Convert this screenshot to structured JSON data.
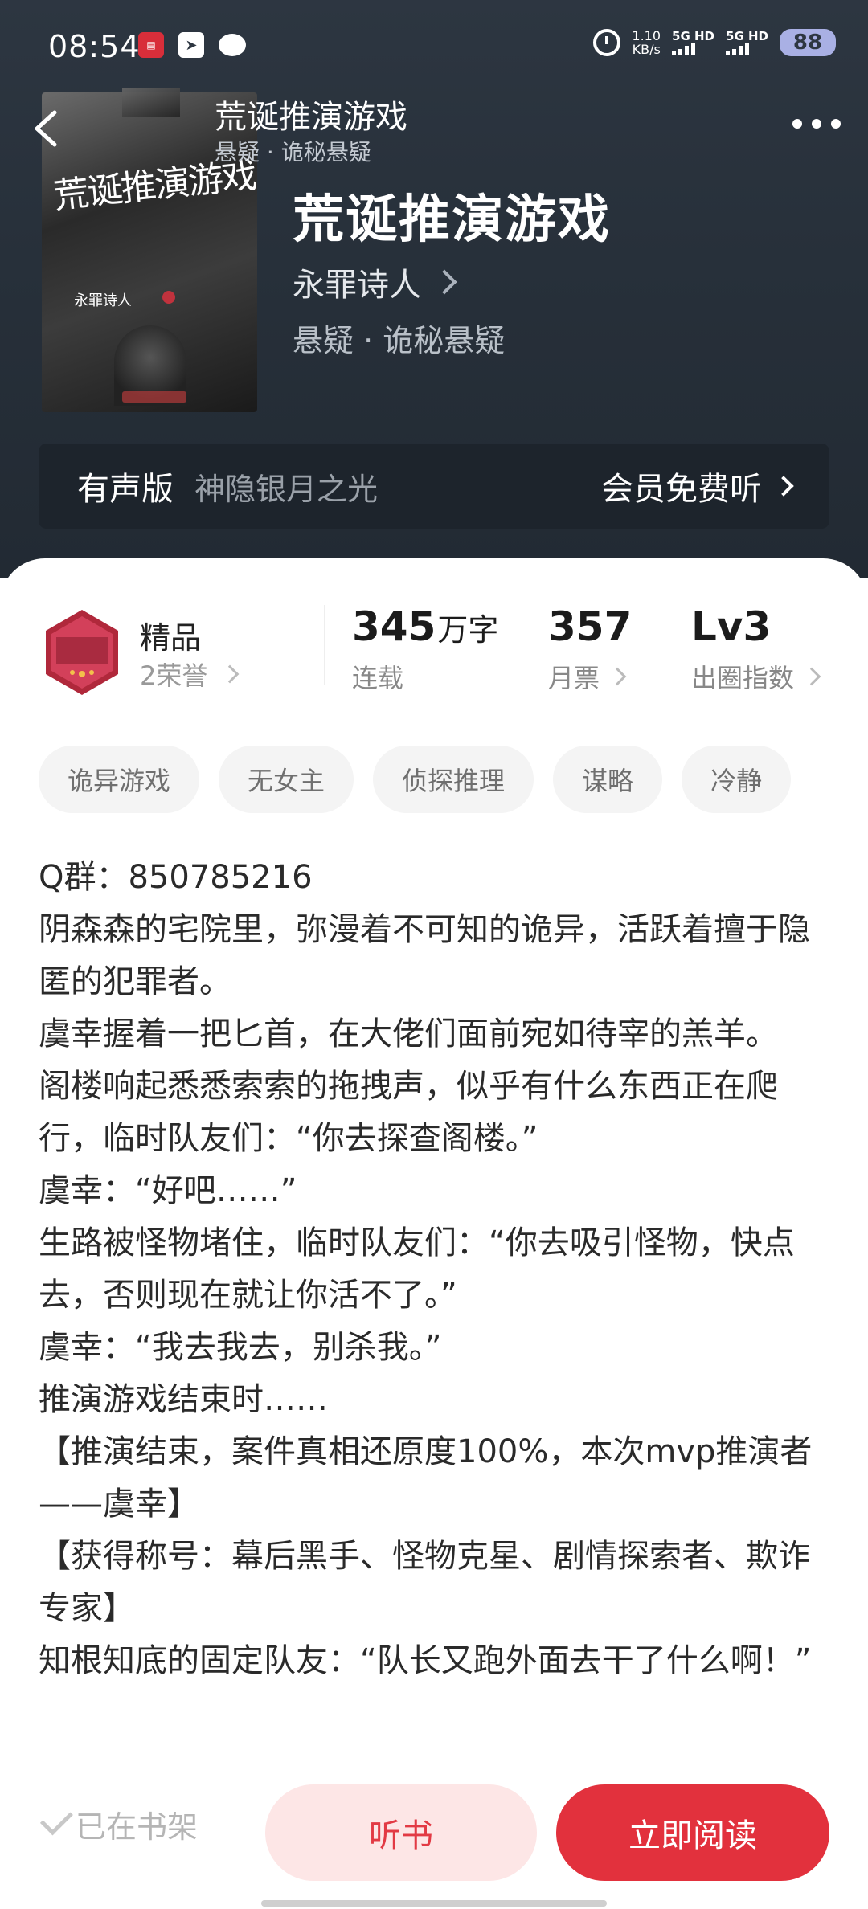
{
  "status_bar": {
    "time": "08:54",
    "net_speed_value": "1.10",
    "net_speed_unit": "KB/s",
    "sim1": "5G HD",
    "sim2": "5G HD",
    "battery": "88"
  },
  "header": {
    "title": "荒诞推演游戏",
    "subtitle": "悬疑 · 诡秘悬疑"
  },
  "book": {
    "title": "荒诞推演游戏",
    "author": "永罪诗人",
    "genre": "悬疑 · 诡秘悬疑",
    "cover_title": "荒诞推演游戏",
    "cover_author": "永罪诗人"
  },
  "audio": {
    "label": "有声版",
    "narrator": "神隐银月之光",
    "cta": "会员免费听"
  },
  "stats": {
    "honor_title": "精品",
    "honor_sub": "2荣誉",
    "words_value": "345",
    "words_unit": "万字",
    "words_label": "连载",
    "monthly_value": "357",
    "monthly_label": "月票",
    "level_value": "Lv3",
    "level_label": "出圈指数"
  },
  "tags": [
    "诡异游戏",
    "无女主",
    "侦探推理",
    "谋略",
    "冷静"
  ],
  "description": [
    "Q群：850785216",
    "阴森森的宅院里，弥漫着不可知的诡异，活跃着擅于隐匿的犯罪者。",
    "虞幸握着一把匕首，在大佬们面前宛如待宰的羔羊。",
    "阁楼响起悉悉索索的拖拽声，似乎有什么东西正在爬行，临时队友们：“你去探查阁楼。”",
    "虞幸：“好吧……”",
    "生路被怪物堵住，临时队友们：“你去吸引怪物，快点去，否则现在就让你活不了。”",
    "虞幸：“我去我去，别杀我。”",
    "推演游戏结束时……",
    "【推演结束，案件真相还原度100%，本次mvp推演者——虞幸】",
    "【获得称号：幕后黑手、怪物克星、剧情探索者、欺诈专家】",
    "知根知底的固定队友：“队长又跑外面去干了什么啊！”"
  ],
  "bottom": {
    "shelf": "已在书架",
    "listen": "听书",
    "read": "立即阅读"
  },
  "colors": {
    "accent": "#e2313d",
    "accent_light": "#fde6e6",
    "hero_bg": "#2d3641"
  }
}
